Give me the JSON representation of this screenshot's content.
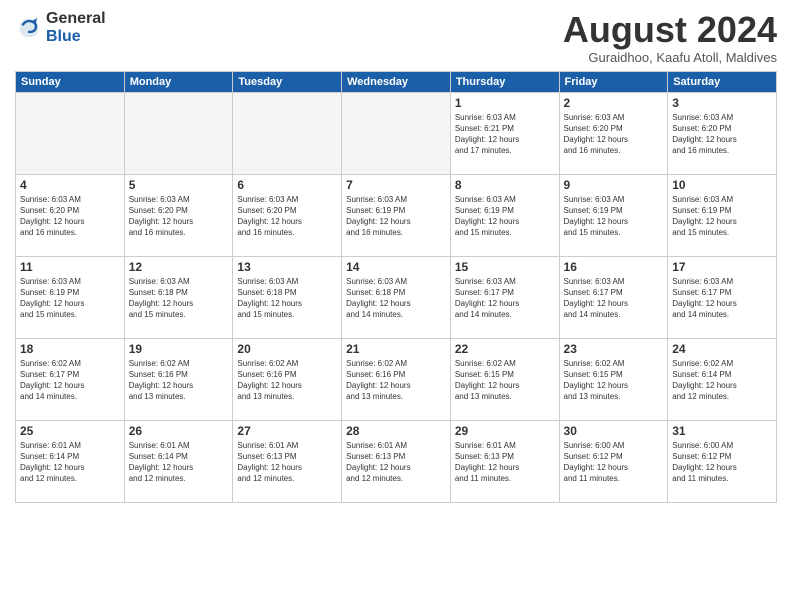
{
  "logo": {
    "general": "General",
    "blue": "Blue"
  },
  "header": {
    "title": "August 2024",
    "subtitle": "Guraidhoo, Kaafu Atoll, Maldives"
  },
  "weekdays": [
    "Sunday",
    "Monday",
    "Tuesday",
    "Wednesday",
    "Thursday",
    "Friday",
    "Saturday"
  ],
  "weeks": [
    [
      {
        "day": "",
        "info": ""
      },
      {
        "day": "",
        "info": ""
      },
      {
        "day": "",
        "info": ""
      },
      {
        "day": "",
        "info": ""
      },
      {
        "day": "1",
        "info": "Sunrise: 6:03 AM\nSunset: 6:21 PM\nDaylight: 12 hours\nand 17 minutes."
      },
      {
        "day": "2",
        "info": "Sunrise: 6:03 AM\nSunset: 6:20 PM\nDaylight: 12 hours\nand 16 minutes."
      },
      {
        "day": "3",
        "info": "Sunrise: 6:03 AM\nSunset: 6:20 PM\nDaylight: 12 hours\nand 16 minutes."
      }
    ],
    [
      {
        "day": "4",
        "info": "Sunrise: 6:03 AM\nSunset: 6:20 PM\nDaylight: 12 hours\nand 16 minutes."
      },
      {
        "day": "5",
        "info": "Sunrise: 6:03 AM\nSunset: 6:20 PM\nDaylight: 12 hours\nand 16 minutes."
      },
      {
        "day": "6",
        "info": "Sunrise: 6:03 AM\nSunset: 6:20 PM\nDaylight: 12 hours\nand 16 minutes."
      },
      {
        "day": "7",
        "info": "Sunrise: 6:03 AM\nSunset: 6:19 PM\nDaylight: 12 hours\nand 16 minutes."
      },
      {
        "day": "8",
        "info": "Sunrise: 6:03 AM\nSunset: 6:19 PM\nDaylight: 12 hours\nand 15 minutes."
      },
      {
        "day": "9",
        "info": "Sunrise: 6:03 AM\nSunset: 6:19 PM\nDaylight: 12 hours\nand 15 minutes."
      },
      {
        "day": "10",
        "info": "Sunrise: 6:03 AM\nSunset: 6:19 PM\nDaylight: 12 hours\nand 15 minutes."
      }
    ],
    [
      {
        "day": "11",
        "info": "Sunrise: 6:03 AM\nSunset: 6:19 PM\nDaylight: 12 hours\nand 15 minutes."
      },
      {
        "day": "12",
        "info": "Sunrise: 6:03 AM\nSunset: 6:18 PM\nDaylight: 12 hours\nand 15 minutes."
      },
      {
        "day": "13",
        "info": "Sunrise: 6:03 AM\nSunset: 6:18 PM\nDaylight: 12 hours\nand 15 minutes."
      },
      {
        "day": "14",
        "info": "Sunrise: 6:03 AM\nSunset: 6:18 PM\nDaylight: 12 hours\nand 14 minutes."
      },
      {
        "day": "15",
        "info": "Sunrise: 6:03 AM\nSunset: 6:17 PM\nDaylight: 12 hours\nand 14 minutes."
      },
      {
        "day": "16",
        "info": "Sunrise: 6:03 AM\nSunset: 6:17 PM\nDaylight: 12 hours\nand 14 minutes."
      },
      {
        "day": "17",
        "info": "Sunrise: 6:03 AM\nSunset: 6:17 PM\nDaylight: 12 hours\nand 14 minutes."
      }
    ],
    [
      {
        "day": "18",
        "info": "Sunrise: 6:02 AM\nSunset: 6:17 PM\nDaylight: 12 hours\nand 14 minutes."
      },
      {
        "day": "19",
        "info": "Sunrise: 6:02 AM\nSunset: 6:16 PM\nDaylight: 12 hours\nand 13 minutes."
      },
      {
        "day": "20",
        "info": "Sunrise: 6:02 AM\nSunset: 6:16 PM\nDaylight: 12 hours\nand 13 minutes."
      },
      {
        "day": "21",
        "info": "Sunrise: 6:02 AM\nSunset: 6:16 PM\nDaylight: 12 hours\nand 13 minutes."
      },
      {
        "day": "22",
        "info": "Sunrise: 6:02 AM\nSunset: 6:15 PM\nDaylight: 12 hours\nand 13 minutes."
      },
      {
        "day": "23",
        "info": "Sunrise: 6:02 AM\nSunset: 6:15 PM\nDaylight: 12 hours\nand 13 minutes."
      },
      {
        "day": "24",
        "info": "Sunrise: 6:02 AM\nSunset: 6:14 PM\nDaylight: 12 hours\nand 12 minutes."
      }
    ],
    [
      {
        "day": "25",
        "info": "Sunrise: 6:01 AM\nSunset: 6:14 PM\nDaylight: 12 hours\nand 12 minutes."
      },
      {
        "day": "26",
        "info": "Sunrise: 6:01 AM\nSunset: 6:14 PM\nDaylight: 12 hours\nand 12 minutes."
      },
      {
        "day": "27",
        "info": "Sunrise: 6:01 AM\nSunset: 6:13 PM\nDaylight: 12 hours\nand 12 minutes."
      },
      {
        "day": "28",
        "info": "Sunrise: 6:01 AM\nSunset: 6:13 PM\nDaylight: 12 hours\nand 12 minutes."
      },
      {
        "day": "29",
        "info": "Sunrise: 6:01 AM\nSunset: 6:13 PM\nDaylight: 12 hours\nand 11 minutes."
      },
      {
        "day": "30",
        "info": "Sunrise: 6:00 AM\nSunset: 6:12 PM\nDaylight: 12 hours\nand 11 minutes."
      },
      {
        "day": "31",
        "info": "Sunrise: 6:00 AM\nSunset: 6:12 PM\nDaylight: 12 hours\nand 11 minutes."
      }
    ]
  ]
}
